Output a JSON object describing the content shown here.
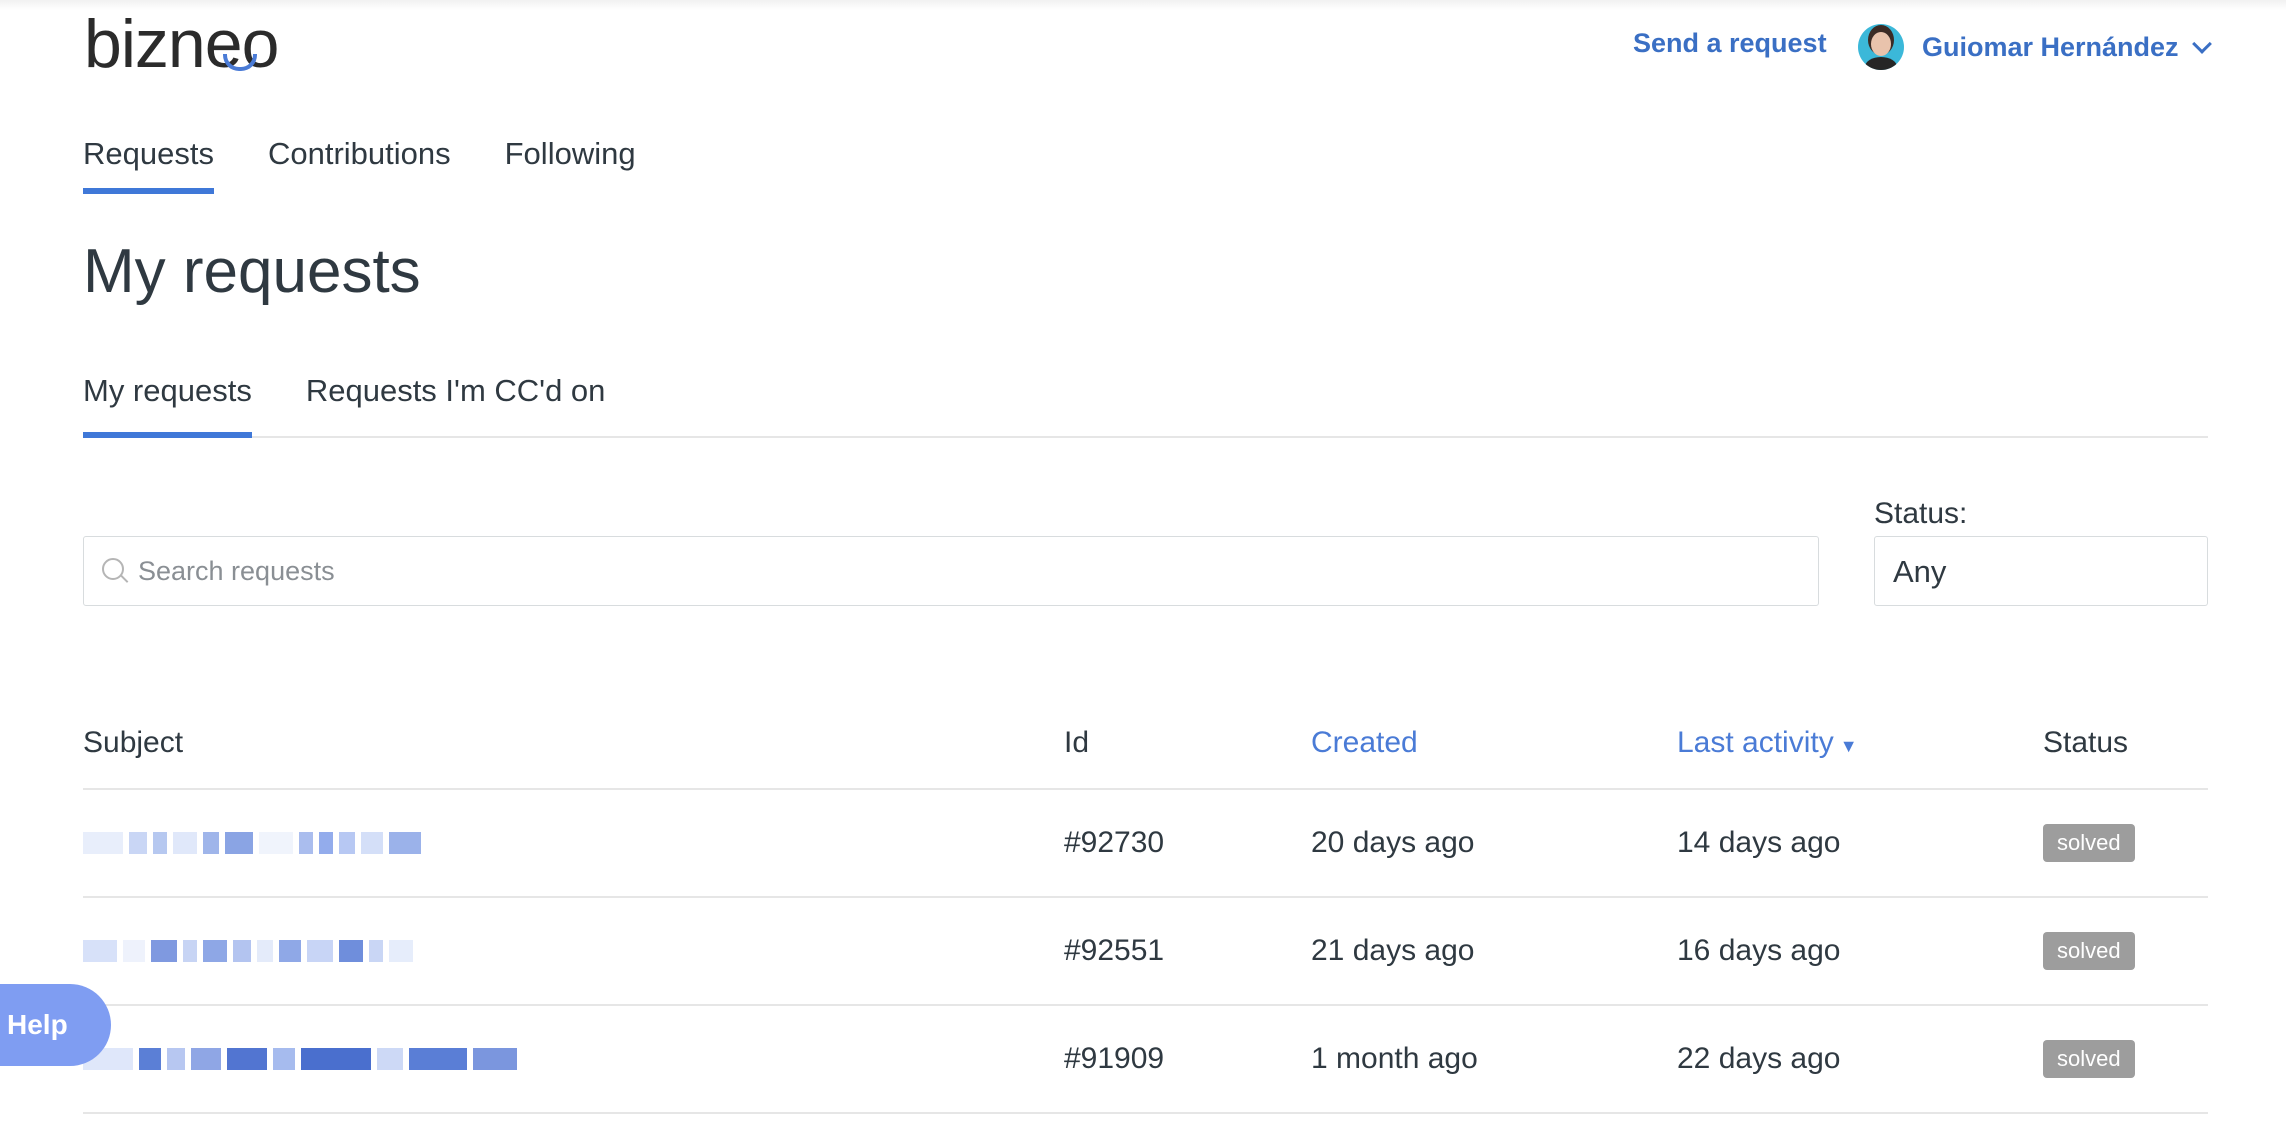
{
  "header": {
    "logo": "bizneo",
    "send_request": "Send a request",
    "user_name": "Guiomar Hernández"
  },
  "nav": {
    "tabs": [
      {
        "label": "Requests",
        "active": true
      },
      {
        "label": "Contributions",
        "active": false
      },
      {
        "label": "Following",
        "active": false
      }
    ]
  },
  "page": {
    "title": "My requests"
  },
  "sub_tabs": [
    {
      "label": "My requests",
      "active": true
    },
    {
      "label": "Requests I'm CC'd on",
      "active": false
    }
  ],
  "search": {
    "placeholder": "Search requests"
  },
  "status_filter": {
    "label": "Status:",
    "value": "Any"
  },
  "table": {
    "headers": {
      "subject": "Subject",
      "id": "Id",
      "created": "Created",
      "last_activity": "Last activity",
      "sort_indicator": "▼",
      "status": "Status"
    },
    "rows": [
      {
        "id": "#92730",
        "created": "20 days ago",
        "last_activity": "14 days ago",
        "status": "solved"
      },
      {
        "id": "#92551",
        "created": "21 days ago",
        "last_activity": "16 days ago",
        "status": "solved"
      },
      {
        "id": "#91909",
        "created": "1 month ago",
        "last_activity": "22 days ago",
        "status": "solved"
      }
    ]
  },
  "help_button": {
    "label": "Help"
  },
  "colors": {
    "accent": "#3f78d8",
    "link": "#3a6fc4",
    "badge_bg": "#9d9d9d",
    "help_bg": "#7f9df2"
  }
}
